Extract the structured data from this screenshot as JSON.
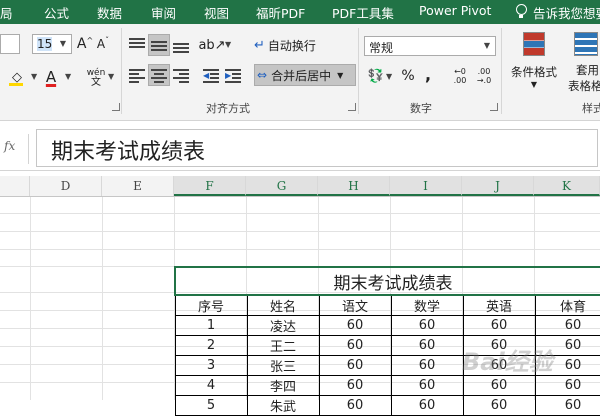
{
  "ribbon_tabs": [
    "局",
    "公式",
    "数据",
    "审阅",
    "视图",
    "福昕PDF",
    "PDF工具集",
    "Power Pivot"
  ],
  "tell_me": "告诉我您想要",
  "font": {
    "size": "15",
    "phonetic": "wén",
    "phonetic_sub": "文"
  },
  "alignment": {
    "wrap_text": "自动换行",
    "merge_center": "合并后居中",
    "group_label": "对齐方式"
  },
  "number": {
    "format": "常规",
    "percent": "%",
    "comma": ",",
    "inc_decimal_top": "←0",
    "inc_decimal_bottom": ".00",
    "dec_decimal_top": ".00",
    "dec_decimal_bottom": "→.0",
    "group_label": "数字"
  },
  "styles": {
    "conditional": "条件格式",
    "table_format_1": "套用",
    "table_format_2": "表格格式",
    "group_label": "样式"
  },
  "formula_bar": {
    "fx": "fx",
    "content": "期末考试成绩表"
  },
  "columns": [
    "D",
    "E",
    "F",
    "G",
    "H",
    "I",
    "J",
    "K"
  ],
  "table": {
    "title": "期末考试成绩表",
    "headers": [
      "序号",
      "姓名",
      "语文",
      "数学",
      "英语",
      "体育"
    ],
    "rows": [
      [
        "1",
        "凌达",
        "60",
        "60",
        "60",
        "60"
      ],
      [
        "2",
        "王二",
        "60",
        "60",
        "60",
        "60"
      ],
      [
        "3",
        "张三",
        "60",
        "60",
        "60",
        "60"
      ],
      [
        "4",
        "李四",
        "60",
        "60",
        "60",
        "60"
      ],
      [
        "5",
        "朱武",
        "60",
        "60",
        "60",
        "60"
      ]
    ]
  },
  "watermark": "Bai经验",
  "colors": {
    "accent": "#217346",
    "ribbon_bg": "#f3f3f3",
    "font_color_red": "#e02020",
    "fill_yellow": "#ffd700"
  }
}
